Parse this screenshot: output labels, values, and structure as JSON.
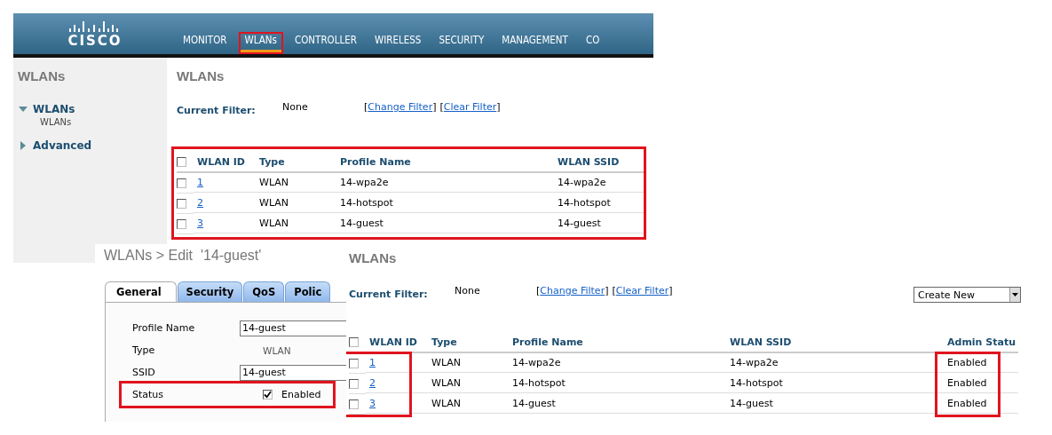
{
  "header": {
    "logo_text": "CISCO",
    "nav": [
      {
        "label": "MONITOR",
        "selected": false,
        "highlighted": false
      },
      {
        "label": "WLANs",
        "selected": true,
        "highlighted": true
      },
      {
        "label": "CONTROLLER",
        "selected": false,
        "highlighted": false
      },
      {
        "label": "WIRELESS",
        "selected": false,
        "highlighted": false
      },
      {
        "label": "SECURITY",
        "selected": false,
        "highlighted": false
      },
      {
        "label": "MANAGEMENT",
        "selected": false,
        "highlighted": false
      },
      {
        "label": "CO",
        "selected": false,
        "highlighted": false
      }
    ]
  },
  "sidebar": {
    "title": "WLANs",
    "tree": [
      {
        "label": "WLANs",
        "expanded": true,
        "children": [
          {
            "label": "WLANs"
          }
        ]
      },
      {
        "label": "Advanced",
        "expanded": false
      }
    ]
  },
  "wlans_list": {
    "title": "WLANs",
    "filter_label": "Current Filter:",
    "filter_value": "None",
    "filter_links": [
      {
        "before": "[",
        "label": "Change Filter",
        "after": "]"
      },
      {
        "before": "[",
        "label": "Clear Filter",
        "after": "]"
      }
    ],
    "highlighted": true,
    "all_checked": false,
    "columns": [
      {
        "label": "WLAN ID",
        "highlighted": false
      },
      {
        "label": "Type",
        "highlighted": false
      },
      {
        "label": "Profile Name",
        "highlighted": false
      },
      {
        "label": "WLAN SSID",
        "highlighted": false
      }
    ],
    "rows": [
      {
        "checked": false,
        "cells": [
          "1",
          "WLAN",
          "14-wpa2e",
          "14-wpa2e"
        ]
      },
      {
        "checked": false,
        "cells": [
          "2",
          "WLAN",
          "14-hotspot",
          "14-hotspot"
        ]
      },
      {
        "checked": false,
        "cells": [
          "3",
          "WLAN",
          "14-guest",
          "14-guest"
        ]
      }
    ]
  },
  "edit": {
    "title": "WLANs > Edit  '14-guest'",
    "tabs": [
      {
        "label": "General",
        "selected": true
      },
      {
        "label": "Security",
        "selected": false
      },
      {
        "label": "QoS",
        "selected": false
      },
      {
        "label": "Polic",
        "selected": false
      }
    ],
    "fields": [
      {
        "kind": "input",
        "label": "Profile Name",
        "value": "14-guest",
        "highlighted": false
      },
      {
        "kind": "text",
        "label": "Type",
        "value": "WLAN",
        "highlighted": false
      },
      {
        "kind": "input",
        "label": "SSID",
        "value": "14-guest",
        "highlighted": false
      },
      {
        "kind": "checkbox",
        "label": "Status",
        "value": "Enabled",
        "checked": true,
        "highlighted": true
      }
    ]
  },
  "wlans_list_2": {
    "title": "WLANs",
    "filter_label": "Current Filter:",
    "filter_value": "None",
    "filter_links": [
      {
        "before": "[",
        "label": "Change Filter",
        "after": "]"
      },
      {
        "before": "[",
        "label": "Clear Filter",
        "after": "]"
      }
    ],
    "create_select": "Create New",
    "all_checked": false,
    "columns": [
      {
        "label": "WLAN ID",
        "highlighted": true
      },
      {
        "label": "Type",
        "highlighted": false
      },
      {
        "label": "Profile Name",
        "highlighted": false
      },
      {
        "label": "WLAN SSID",
        "highlighted": false
      },
      {
        "label": "Admin Statu",
        "highlighted": true
      }
    ],
    "rows": [
      {
        "checked": false,
        "cells": [
          "1",
          "WLAN",
          "14-wpa2e",
          "14-wpa2e",
          "Enabled"
        ]
      },
      {
        "checked": false,
        "cells": [
          "2",
          "WLAN",
          "14-hotspot",
          "14-hotspot",
          "Enabled"
        ]
      },
      {
        "checked": false,
        "cells": [
          "3",
          "WLAN",
          "14-guest",
          "14-guest",
          "Enabled"
        ]
      }
    ]
  }
}
